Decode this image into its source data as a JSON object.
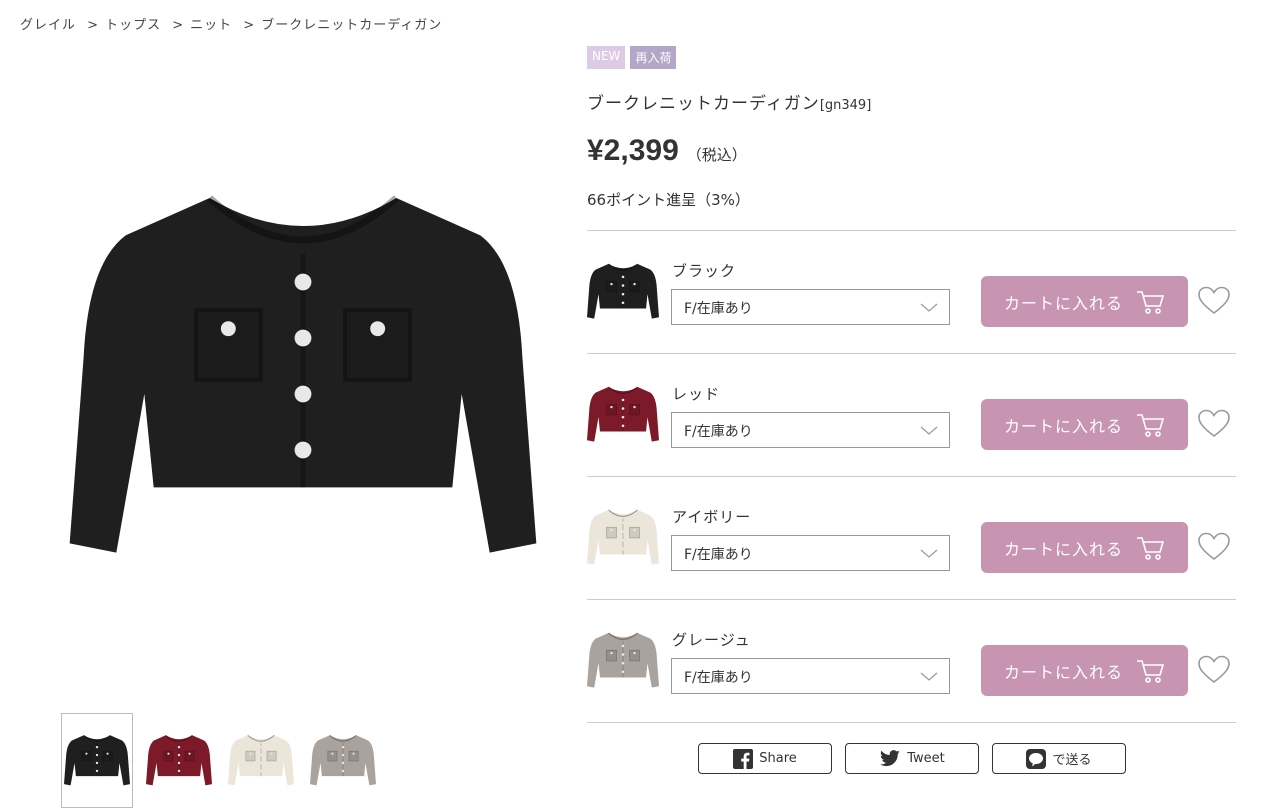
{
  "breadcrumb": [
    {
      "label": "グレイル"
    },
    {
      "sep": ">",
      "label": "トップス"
    },
    {
      "sep": ">",
      "label": "ニット"
    },
    {
      "sep": ">",
      "label": "ブークレニットカーディガン"
    }
  ],
  "badges": {
    "new": "NEW",
    "restock": "再入荷"
  },
  "product": {
    "name": "ブークレニットカーディガン",
    "code": "[gn349]",
    "price": "¥2,399",
    "tax_note": "（税込）",
    "points": "66ポイント進呈（3%）"
  },
  "variants": [
    {
      "color": "ブラック",
      "option": "F/在庫あり",
      "cart_label": "カートに入れる",
      "swatch": "#1f1f1f"
    },
    {
      "color": "レッド",
      "option": "F/在庫あり",
      "cart_label": "カートに入れる",
      "swatch": "#7d1a2a"
    },
    {
      "color": "アイボリー",
      "option": "F/在庫あり",
      "cart_label": "カートに入れる",
      "swatch": "#ece6da"
    },
    {
      "color": "グレージュ",
      "option": "F/在庫あり",
      "cart_label": "カートに入れる",
      "swatch": "#aaa39d"
    }
  ],
  "thumbnails": [
    {
      "swatch": "#1f1f1f"
    },
    {
      "swatch": "#7d1a2a"
    },
    {
      "swatch": "#ece6da"
    },
    {
      "swatch": "#aaa39d"
    }
  ],
  "share": {
    "facebook": "Share",
    "twitter": "Tweet",
    "line": "で送る"
  },
  "colors": {
    "accent": "#c795b1",
    "badge_new": "#ddcbe6",
    "badge_restock": "#b3a6c9"
  },
  "icons": [
    "cart-icon",
    "heart-icon",
    "chevron-down-icon",
    "facebook-icon",
    "twitter-icon",
    "line-icon"
  ]
}
